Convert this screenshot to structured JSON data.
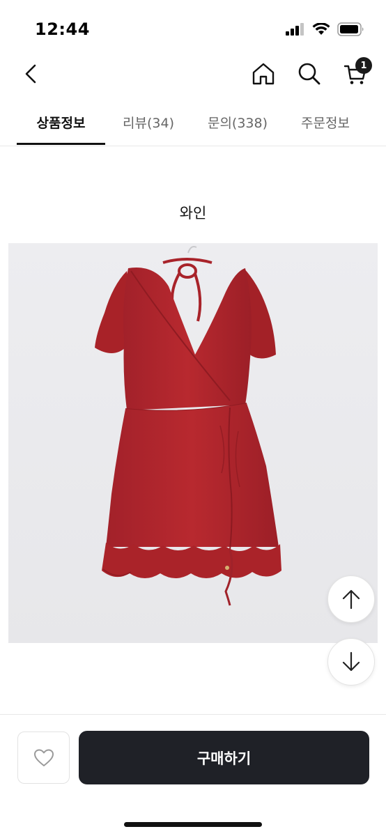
{
  "status_bar": {
    "time": "12:44"
  },
  "nav": {
    "cart_count": "1",
    "icons": [
      "chevron-left-icon",
      "home-icon",
      "search-icon",
      "cart-icon"
    ]
  },
  "tabs": [
    {
      "label": "상품정보",
      "active": true
    },
    {
      "label": "리뷰(34)",
      "active": false
    },
    {
      "label": "문의(338)",
      "active": false
    },
    {
      "label": "주문정보",
      "active": false
    }
  ],
  "product": {
    "color_label": "와인",
    "image_subject": "red-wrap-mini-dress"
  },
  "bottom_bar": {
    "buy_label": "구매하기"
  },
  "colors": {
    "accent": "#1f2127",
    "dress": "#b3282b",
    "image_bg": "#ececef"
  }
}
